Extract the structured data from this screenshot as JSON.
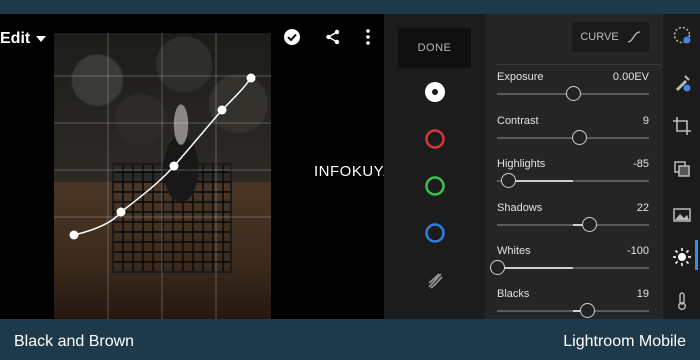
{
  "topbar": {
    "edit_label": "Edit"
  },
  "watermark": "INFOKUY.NET",
  "channels": {
    "done_label": "DONE",
    "items": [
      {
        "name": "luminance",
        "color": "#ffffff"
      },
      {
        "name": "red",
        "color": "#d03a3a"
      },
      {
        "name": "green",
        "color": "#3ac24a"
      },
      {
        "name": "blue",
        "color": "#2f7ee0"
      },
      {
        "name": "split-tone",
        "color": "#9a9a9a"
      }
    ]
  },
  "panel": {
    "curve_label": "CURVE",
    "adjustments": [
      {
        "label": "Exposure",
        "value": "0.00EV",
        "level": 0.0
      },
      {
        "label": "Contrast",
        "value": "9",
        "level": 9
      },
      {
        "label": "Highlights",
        "value": "-85",
        "level": -85
      },
      {
        "label": "Shadows",
        "value": "22",
        "level": 22
      },
      {
        "label": "Whites",
        "value": "-100",
        "level": -100
      },
      {
        "label": "Blacks",
        "value": "19",
        "level": 19
      }
    ]
  },
  "tools": [
    "auto-icon",
    "selective-icon",
    "crop-icon",
    "presets-icon",
    "image-icon",
    "light-icon",
    "temperature-icon"
  ],
  "footer": {
    "left": "Black and Brown",
    "right": "Lightroom Mobile"
  },
  "colors": {
    "accent": "#3d8ad9",
    "background": "#1e3a4a"
  }
}
